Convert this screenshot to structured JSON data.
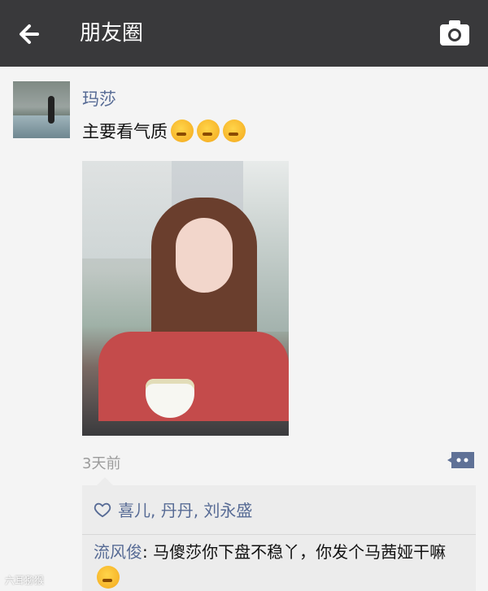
{
  "header": {
    "title": "朋友圈"
  },
  "post": {
    "author": "玛莎",
    "text": "主要看气质",
    "time_ago": "3天前"
  },
  "interactions": {
    "likes": "喜儿, 丹丹, 刘永盛",
    "comments": [
      {
        "author": "流风俊",
        "text": ": 马傻莎你下盘不稳丫，你发个马茜娅干嘛"
      }
    ]
  },
  "watermark": {
    "text": "六耳猕猴"
  },
  "icons": {
    "back": "back-arrow-icon",
    "camera": "camera-icon",
    "comment": "comment-icon",
    "like": "heart-icon",
    "emoji": "thinking-emoji-icon"
  },
  "colors": {
    "header_bg": "#39393b",
    "link_blue": "#576b95"
  }
}
